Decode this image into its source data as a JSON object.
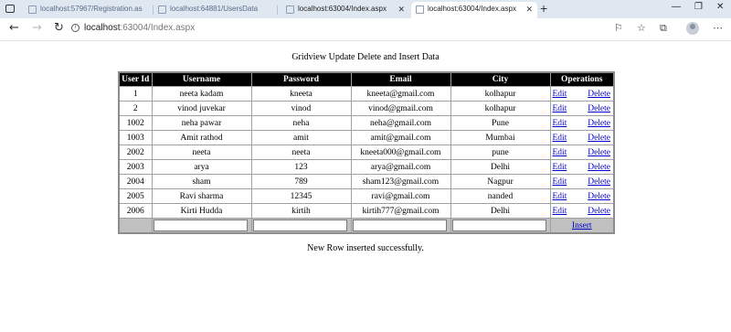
{
  "browser": {
    "tabs": [
      {
        "label": "localhost:57967/Registration.as",
        "active": false
      },
      {
        "label": "localhost:64881/UsersData",
        "active": false
      },
      {
        "label": "localhost:63004/Index.aspx",
        "active": false
      },
      {
        "label": "localhost:63004/Index.aspx",
        "active": true
      }
    ],
    "url_host": "localhost",
    "url_path": ":63004/Index.aspx"
  },
  "page": {
    "title": "Gridview Update Delete and Insert Data",
    "message": "New Row inserted successfully."
  },
  "grid": {
    "headers": [
      "User Id",
      "Username",
      "Password",
      "Email",
      "City",
      "Operations"
    ],
    "rows": [
      {
        "id": "1",
        "username": "neeta kadam",
        "password": "kneeta",
        "email": "kneeta@gmail.com",
        "city": "kolhapur"
      },
      {
        "id": "2",
        "username": "vinod juvekar",
        "password": "vinod",
        "email": "vinod@gmail.com",
        "city": "kolhapur"
      },
      {
        "id": "1002",
        "username": "neha pawar",
        "password": "neha",
        "email": "neha@gmail.com",
        "city": "Pune"
      },
      {
        "id": "1003",
        "username": "Amit rathod",
        "password": "amit",
        "email": "amit@gmail.com",
        "city": "Mumbai"
      },
      {
        "id": "2002",
        "username": "neeta",
        "password": "neeta",
        "email": "kneeta000@gmail.com",
        "city": "pune"
      },
      {
        "id": "2003",
        "username": "arya",
        "password": "123",
        "email": "arya@gmail.com",
        "city": "Delhi"
      },
      {
        "id": "2004",
        "username": "sham",
        "password": "789",
        "email": "sham123@gmail.com",
        "city": "Nagpur"
      },
      {
        "id": "2005",
        "username": "Ravi sharma",
        "password": "12345",
        "email": "ravi@gmail.com",
        "city": "nanded"
      },
      {
        "id": "2006",
        "username": "Kirti Hudda",
        "password": "kirtih",
        "email": "kirtih777@gmail.com",
        "city": "Delhi"
      }
    ],
    "edit_label": "Edit",
    "delete_label": "Delete",
    "insert_label": "Insert",
    "insert_fields": {
      "username": "",
      "password": "",
      "email": "",
      "city": ""
    }
  },
  "colors": {
    "header_bg": "#000000",
    "footer_bg": "#c0c0c0",
    "link": "#0000cc"
  }
}
